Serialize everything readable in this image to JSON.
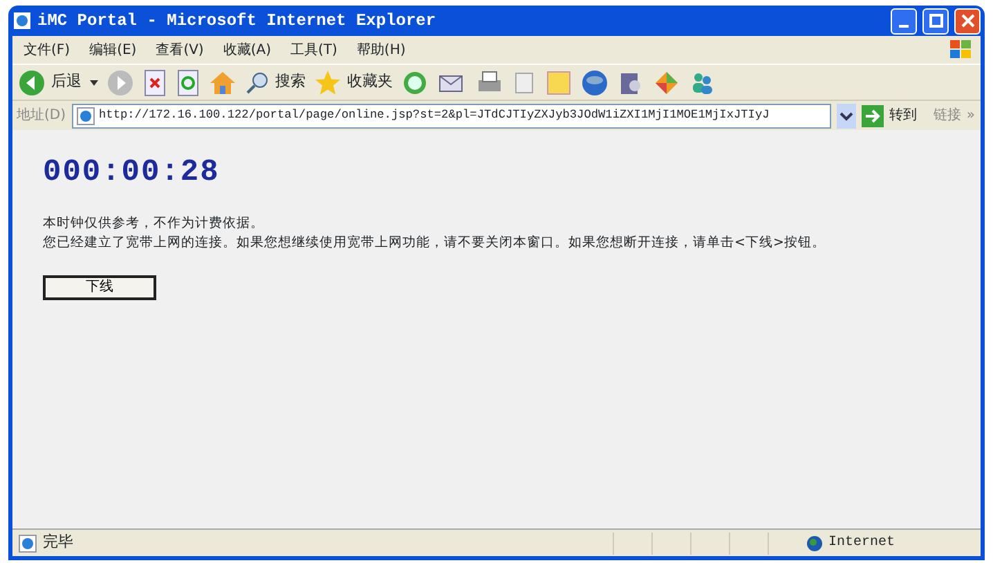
{
  "window": {
    "title": "iMC Portal - Microsoft Internet Explorer"
  },
  "menu": [
    "文件(F)",
    "编辑(E)",
    "查看(V)",
    "收藏(A)",
    "工具(T)",
    "帮助(H)"
  ],
  "toolbar": {
    "back": "后退",
    "search": "搜索",
    "favorites": "收藏夹"
  },
  "address": {
    "label": "地址(D)",
    "value": "http://172.16.100.122/portal/page/online.jsp?st=2&pl=JTdCJTIyZXJyb3JOdW1iZXI1MjI1MOE1MjIxJTIyJ",
    "go": "转到",
    "links": "链接",
    "more": "»"
  },
  "page": {
    "timer": "000:00:28",
    "notes": [
      "本时钟仅供参考，不作为计费依据。",
      "您已经建立了宽带上网的连接。如果您想继续使用宽带上网功能，请不要关闭本窗口。如果您想断开连接，请单击<下线>按钮。"
    ],
    "button": "下线"
  },
  "status_bar": {
    "text": "完毕",
    "zone": "Internet"
  }
}
